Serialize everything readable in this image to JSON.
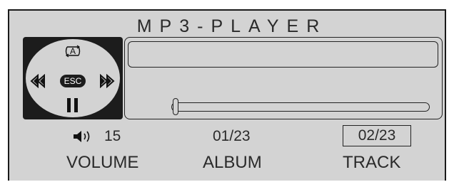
{
  "title": "MP3-PLAYER",
  "controls": {
    "mode_label": "A",
    "esc_label": "ESC"
  },
  "display": {
    "text": "",
    "progress": 0.0
  },
  "status": {
    "volume_value": "15",
    "album_value": "01/23",
    "track_value": "02/23",
    "volume_label": "VOLUME",
    "album_label": "ALBUM",
    "track_label": "TRACK"
  },
  "icons": {
    "mode": "repeat-a-icon",
    "rewind": "rewind-icon",
    "forward": "fast-forward-icon",
    "pause": "pause-icon",
    "volume": "speaker-icon"
  }
}
